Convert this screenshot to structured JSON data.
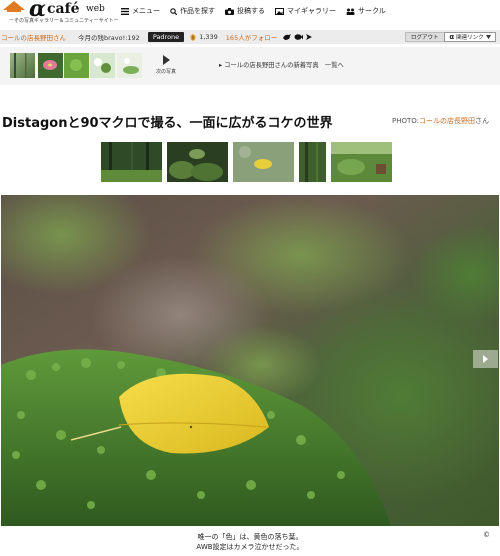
{
  "logo": {
    "alpha": "α",
    "cafe": "café",
    "web": "web",
    "tagline": "ーその写真ギャラリー＆コミュニティーサイトー"
  },
  "nav": [
    {
      "label": "メニュー",
      "icon": "menu-icon"
    },
    {
      "label": "作品を探す",
      "icon": "search-icon"
    },
    {
      "label": "投稿する",
      "icon": "camera-icon"
    },
    {
      "label": "マイギャラリー",
      "icon": "gallery-icon"
    },
    {
      "label": "サークル",
      "icon": "circle-icon"
    }
  ],
  "status": {
    "user": "コールの店長野田さん",
    "bravo": "今月の残bravo!:192",
    "badge": "Padrone",
    "points": "1,339",
    "follow": "165人がフォロー",
    "logout": "ログアウト",
    "fulllink": "関連リンク"
  },
  "gallery": {
    "next": "次の写真",
    "new_link": "コールの店長野田さんの新着写真　一覧へ"
  },
  "title": "Distagonと90マクロで撮る、一面に広がるコケの世界",
  "credit": {
    "prefix": "PHOTO:",
    "name": "コールの店長野田",
    "suffix": "さん"
  },
  "caption": {
    "line1": "唯一の「色」は、黄色の落ち葉。",
    "line2": "AWB設定はカメラ泣かせだった。",
    "copyright": "©"
  },
  "colors": {
    "accent": "#c96a1c",
    "strip": "#ececec"
  }
}
